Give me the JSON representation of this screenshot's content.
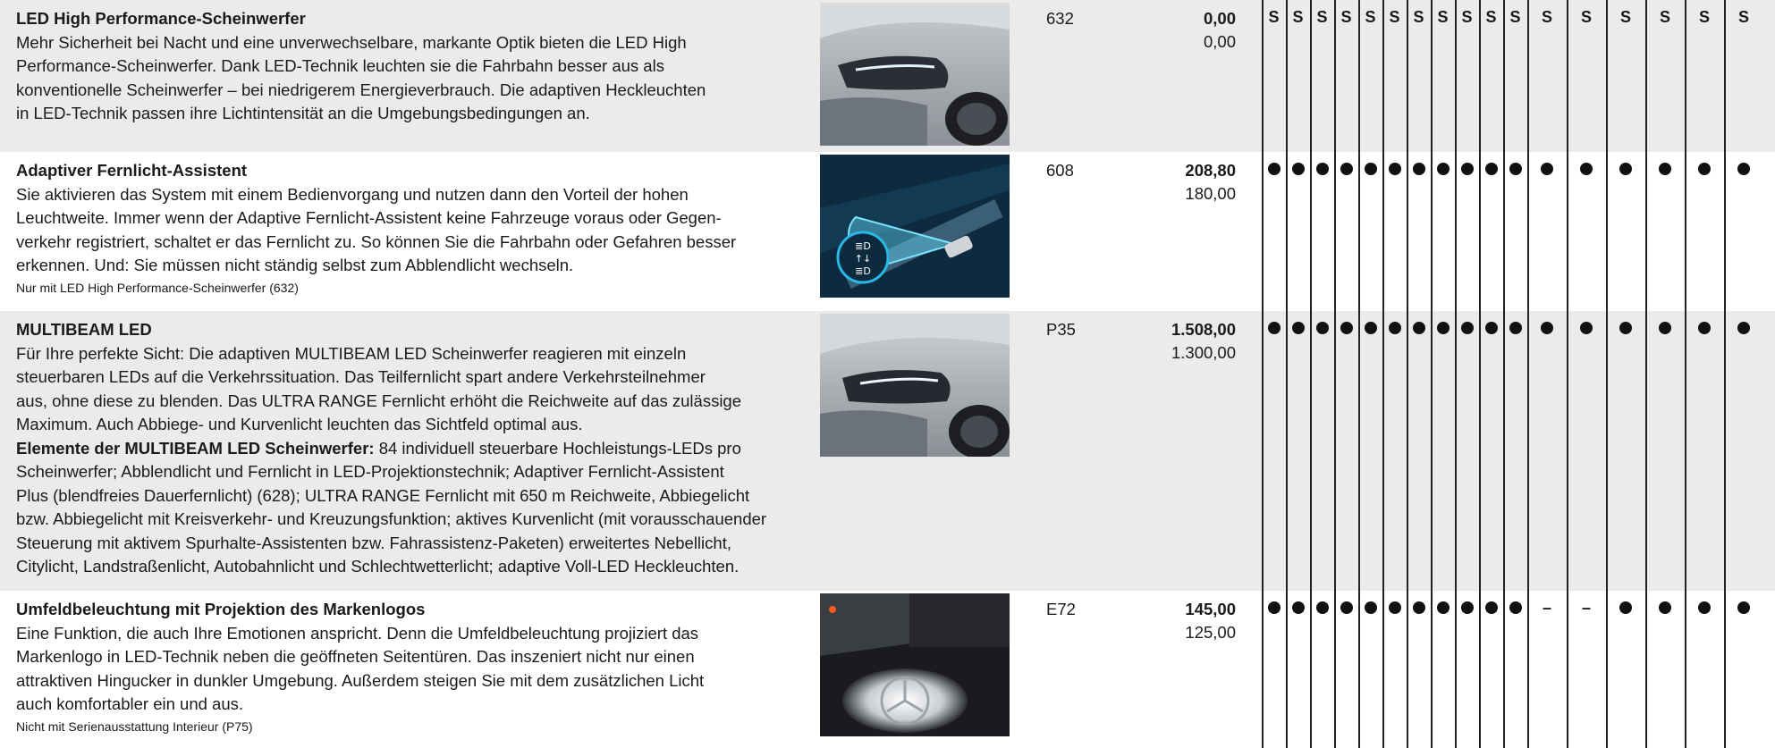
{
  "rows": [
    {
      "title": "LED High Performance-Scheinwerfer",
      "lines": [
        "Mehr Sicherheit bei Nacht und eine unverwechselbare, markante Optik bieten die LED High",
        "Performance-Scheinwerfer. Dank LED-Technik leuchten sie die Fahrbahn besser aus als",
        "konventionelle Scheinwerfer – bei niedrigerem Energieverbrauch. Die adaptiven Heckleuchten",
        "in LED-Technik passen ihre Lichtintensität an die Umgebungsbedingungen an."
      ],
      "code": "632",
      "price_gross": "0,00",
      "price_net": "0,00",
      "cells": [
        "S",
        "S",
        "S",
        "S",
        "S",
        "S",
        "S",
        "S",
        "S",
        "S",
        "S",
        "S",
        "S",
        "S",
        "S",
        "S",
        "S"
      ]
    },
    {
      "title": "Adaptiver Fernlicht-Assistent",
      "lines": [
        "Sie aktivieren das System mit einem Bedienvorgang und nutzen dann den Vorteil der hohen",
        "Leuchtweite. Immer wenn der Adaptive Fernlicht-Assistent keine Fahrzeuge voraus oder Gegen-",
        "verkehr registriert, schaltet er das Fernlicht zu. So können Sie die Fahrbahn oder Gefahren besser",
        "erkennen. Und: Sie müssen nicht ständig selbst zum Abblendlicht wechseln."
      ],
      "note": "Nur mit LED High Performance-Scheinwerfer (632)",
      "code": "608",
      "price_gross": "208,80",
      "price_net": "180,00",
      "cells": [
        "dot",
        "dot",
        "dot",
        "dot",
        "dot",
        "dot",
        "dot",
        "dot",
        "dot",
        "dot",
        "dot",
        "dot",
        "dot",
        "dot",
        "dot",
        "dot",
        "dot"
      ]
    },
    {
      "title": "MULTIBEAM LED",
      "lines": [
        "Für Ihre perfekte Sicht: Die adaptiven MULTIBEAM LED Scheinwerfer reagieren mit einzeln",
        "steuerbaren LEDs auf die Verkehrssituation. Das Teilfernlicht spart andere Verkehrsteilnehmer",
        "aus, ohne diese zu blenden. Das ULTRA RANGE Fernlicht erhöht die Reichweite auf das zulässige",
        "Maximum. Auch Abbiege- und Kurvenlicht leuchten das Sichtfeld optimal aus."
      ],
      "elements_label": "Elemente der MULTIBEAM LED Scheinwerfer:",
      "elements_lines": [
        " 84 individuell steuerbare Hochleistungs-LEDs pro",
        "Scheinwerfer; Abblendlicht und Fernlicht in LED-Projektionstechnik; Adaptiver Fernlicht-Assistent",
        "Plus (blendfreies Dauerfernlicht) (628); ULTRA RANGE Fernlicht mit 650 m Reichweite, Abbiegelicht",
        "bzw. Abbiegelicht mit Kreisverkehr- und Kreuzungsfunktion; aktives Kurvenlicht (mit vorausschauender",
        "Steuerung mit aktivem Spurhalte-Assistenten bzw. Fahrassistenz-Paketen) erweitertes Nebellicht,",
        "Citylicht, Landstraßenlicht, Autobahnlicht und Schlechtwetterlicht; adaptive Voll-LED Heckleuchten."
      ],
      "code": "P35",
      "price_gross": "1.508,00",
      "price_net": "1.300,00",
      "cells": [
        "dot",
        "dot",
        "dot",
        "dot",
        "dot",
        "dot",
        "dot",
        "dot",
        "dot",
        "dot",
        "dot",
        "dot",
        "dot",
        "dot",
        "dot",
        "dot",
        "dot"
      ]
    },
    {
      "title": "Umfeldbeleuchtung mit Projektion des Markenlogos",
      "lines": [
        "Eine Funktion, die auch Ihre Emotionen anspricht. Denn die Umfeldbeleuchtung projiziert das",
        "Markenlogo in LED-Technik neben die geöffneten Seitentüren. Das inszeniert nicht nur einen",
        "attraktiven Hingucker in dunkler Umgebung. Außerdem steigen Sie mit dem zusätzlichen Licht",
        "auch komfortabler ein und aus."
      ],
      "note": "Nicht mit Serienausstattung Interieur (P75)",
      "code": "E72",
      "price_gross": "145,00",
      "price_net": "125,00",
      "cells": [
        "dot",
        "dot",
        "dot",
        "dot",
        "dot",
        "dot",
        "dot",
        "dot",
        "dot",
        "dot",
        "dot",
        "–",
        "–",
        "dot",
        "dot",
        "dot",
        "dot"
      ]
    }
  ]
}
